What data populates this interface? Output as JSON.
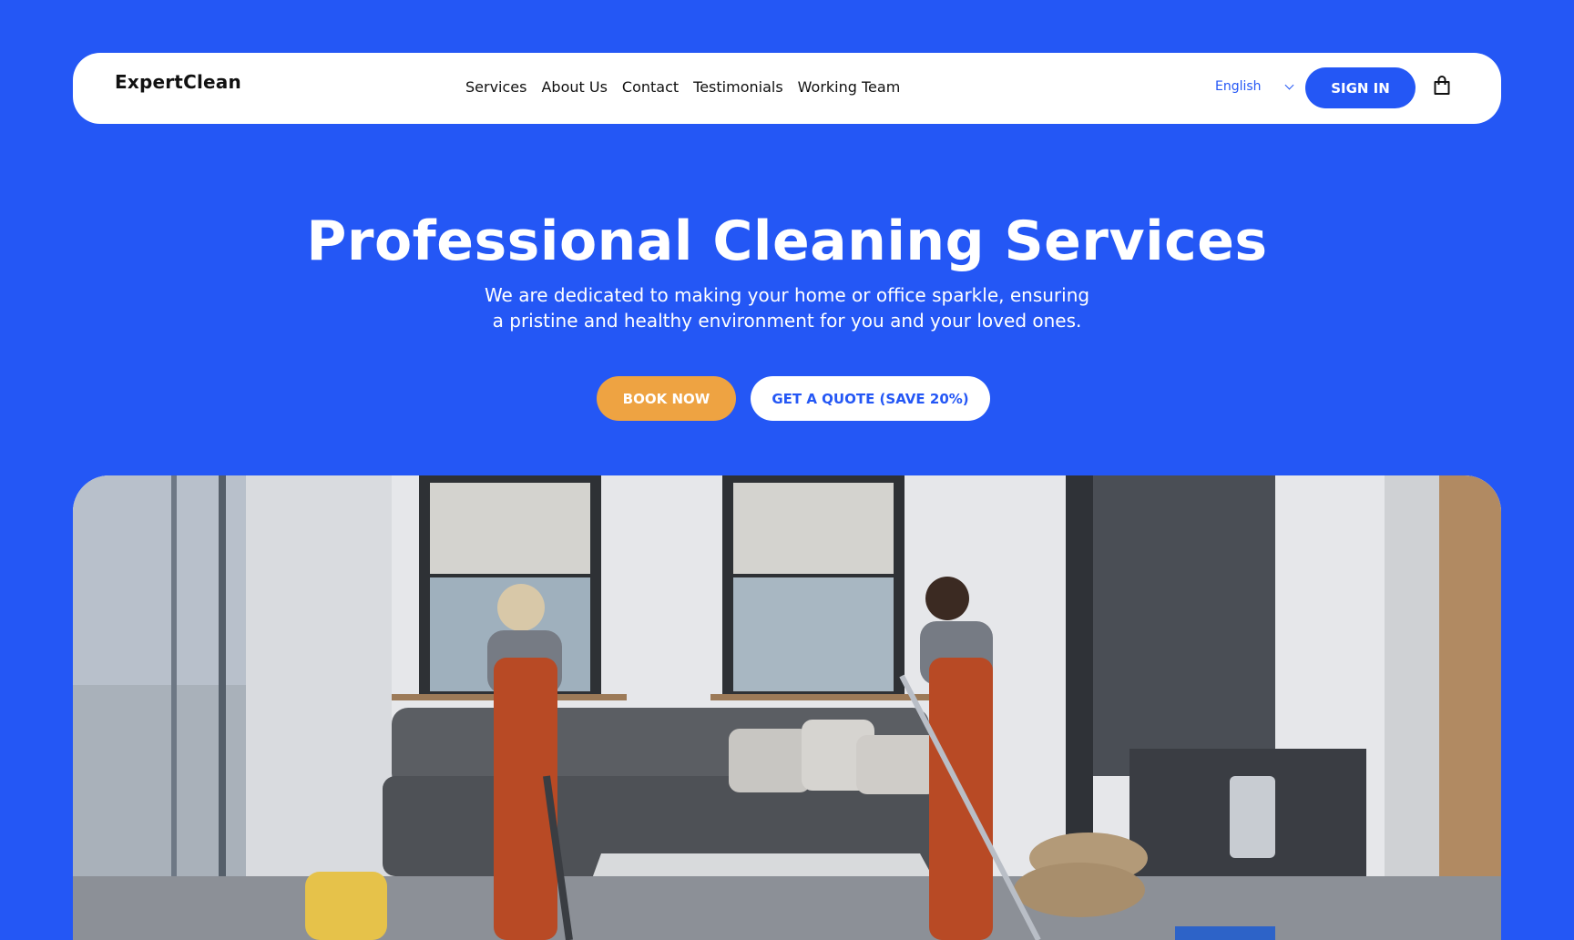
{
  "brand": {
    "name": "ExpertClean",
    "accent_color": "#2457f5",
    "highlight_color": "#eea342"
  },
  "nav": {
    "links": [
      {
        "label": "Services"
      },
      {
        "label": "About Us"
      },
      {
        "label": "Contact"
      },
      {
        "label": "Testimonials"
      },
      {
        "label": "Working Team"
      }
    ],
    "language": "English",
    "signin_label": "SIGN IN",
    "cart_icon": "shopping-bag-icon"
  },
  "hero": {
    "title": "Professional Cleaning Services",
    "subtitle_line1": "We are dedicated to making your home or office sparkle, ensuring",
    "subtitle_line2": "a pristine and healthy environment for you and your loved ones.",
    "book_label": "BOOK NOW",
    "quote_label": "GET A QUOTE (SAVE 20%)"
  }
}
